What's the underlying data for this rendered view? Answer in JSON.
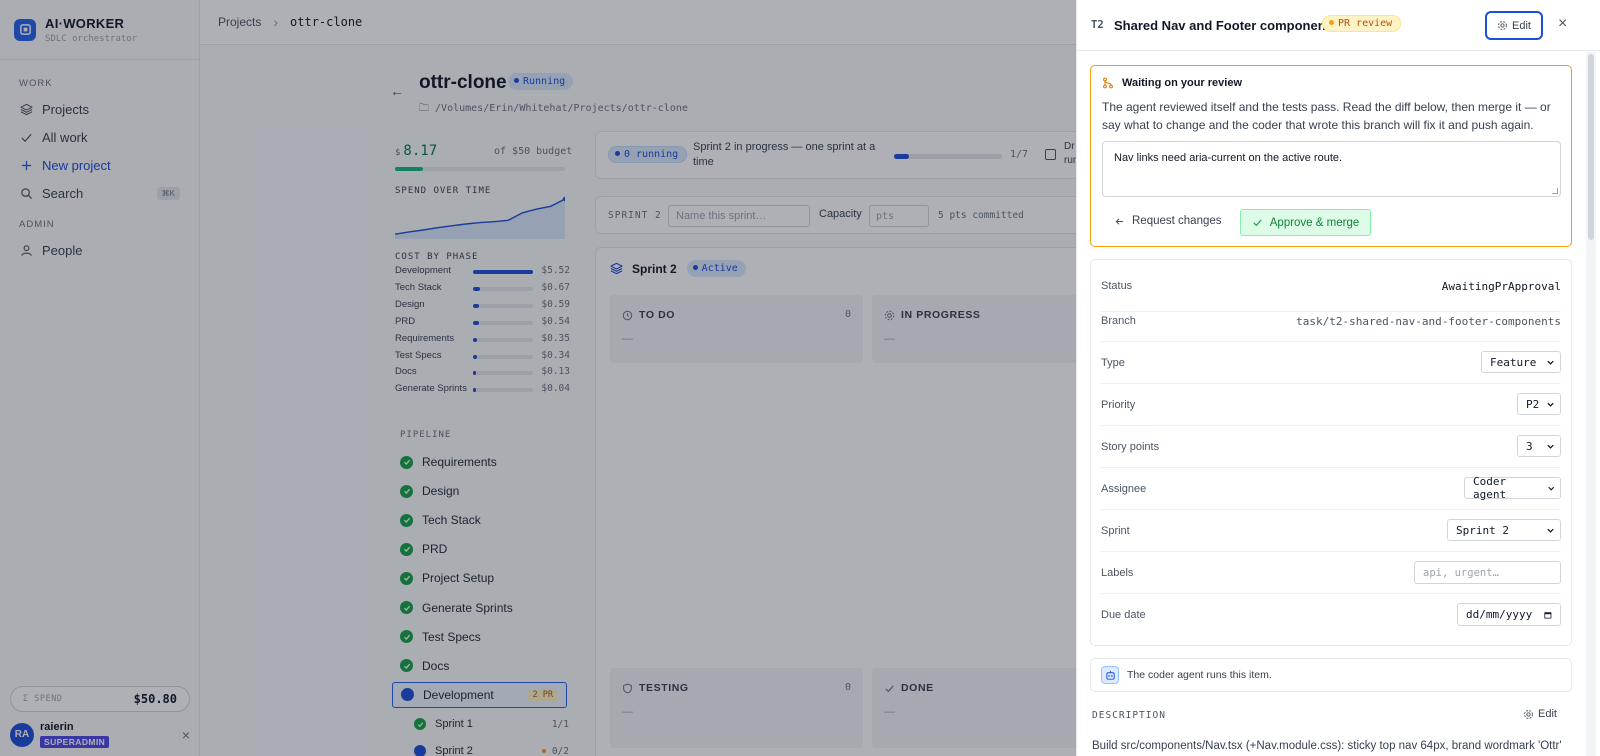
{
  "sidebar": {
    "brand": {
      "name": "AI·WORKER",
      "subtitle": "SDLC orchestrator"
    },
    "sections": {
      "work": "WORK",
      "admin": "ADMIN"
    },
    "items": [
      {
        "label": "Projects",
        "icon": "layers-icon"
      },
      {
        "label": "All work",
        "icon": "check-icon"
      },
      {
        "label": "New project",
        "icon": "plus-icon"
      },
      {
        "label": "Search",
        "icon": "search-icon",
        "shortcut": "⌘K"
      },
      {
        "label": "People",
        "icon": "person-icon"
      }
    ],
    "spend": {
      "label": "Σ SPEND",
      "value": "$50.80"
    },
    "user": {
      "initials": "RA",
      "name": "raierin",
      "role": "SUPERADMIN"
    }
  },
  "breadcrumb": {
    "root": "Projects",
    "current": "ottr-clone"
  },
  "project": {
    "name": "ottr-clone",
    "status": "Running",
    "path": "/Volumes/Erin/Whitehat/Projects/ottr-clone",
    "cost": {
      "currency": "$",
      "value": "8.17",
      "budget_text": "of $50 budget",
      "fraction": 0.163
    },
    "labels": {
      "spend_over_time": "SPEND OVER TIME",
      "cost_by_phase": "COST BY PHASE",
      "pipeline": "PIPELINE"
    },
    "spend_series": [
      0.6,
      1.1,
      1.5,
      2.0,
      2.4,
      2.8,
      3.1,
      3.3,
      3.6,
      5.2,
      6.0,
      6.6,
      8.17
    ],
    "phases": [
      {
        "name": "Development",
        "value": "$5.52",
        "amount": 5.52
      },
      {
        "name": "Tech Stack",
        "value": "$0.67",
        "amount": 0.67
      },
      {
        "name": "Design",
        "value": "$0.59",
        "amount": 0.59
      },
      {
        "name": "PRD",
        "value": "$0.54",
        "amount": 0.54
      },
      {
        "name": "Requirements",
        "value": "$0.35",
        "amount": 0.35
      },
      {
        "name": "Test Specs",
        "value": "$0.34",
        "amount": 0.34
      },
      {
        "name": "Docs",
        "value": "$0.13",
        "amount": 0.13
      },
      {
        "name": "Generate Sprints",
        "value": "$0.04",
        "amount": 0.04
      }
    ],
    "pipeline": [
      {
        "name": "Requirements"
      },
      {
        "name": "Design"
      },
      {
        "name": "Tech Stack"
      },
      {
        "name": "PRD"
      },
      {
        "name": "Project Setup"
      },
      {
        "name": "Generate Sprints"
      },
      {
        "name": "Test Specs"
      },
      {
        "name": "Docs"
      },
      {
        "name": "Development",
        "badge": "2 PR"
      }
    ],
    "sprints": [
      {
        "name": "Sprint 1",
        "count": "1/1"
      },
      {
        "name": "Sprint 2",
        "count": "0/2"
      }
    ]
  },
  "status_card": {
    "running": "0 running",
    "text": "Sprint 2 in progress — one sprint at a time",
    "progress": "1/7",
    "progress_fraction": 0.143,
    "dry_run_label": "Dr\nrun"
  },
  "sprint_bar": {
    "label": "SPRINT 2",
    "name_placeholder": "Name this sprint…",
    "capacity_label": "Capacity",
    "capacity_placeholder": "pts",
    "committed": "5 pts committed"
  },
  "board": {
    "name": "Sprint 2",
    "status": "Active",
    "columns": [
      {
        "title": "TO DO",
        "count": "0",
        "empty": "—"
      },
      {
        "title": "IN PROGRESS",
        "count": "",
        "empty": "—"
      },
      {
        "title": "TESTING",
        "count": "0",
        "empty": "—"
      },
      {
        "title": "DONE",
        "count": "",
        "empty": "—"
      }
    ]
  },
  "drawer": {
    "task_id": "T2",
    "title": "Shared Nav and Footer components",
    "status_pill": "PR review",
    "edit_label": "Edit",
    "close": "×",
    "review": {
      "heading": "Waiting on your review",
      "text": "The agent reviewed itself and the tests pass. Read the diff below, then merge it — or say what to change and the coder that wrote this branch will fix it and push again.",
      "feedback": "Nav links need aria-current on the active route.",
      "request_changes": "Request changes",
      "approve": "Approve & merge"
    },
    "fields": {
      "status": {
        "label": "Status",
        "value": "AwaitingPrApproval"
      },
      "branch": {
        "label": "Branch",
        "value": "task/t2-shared-nav-and-footer-components"
      },
      "type": {
        "label": "Type",
        "value": "Feature"
      },
      "priority": {
        "label": "Priority",
        "value": "P2"
      },
      "points": {
        "label": "Story points",
        "value": "3"
      },
      "assignee": {
        "label": "Assignee",
        "value": "Coder agent"
      },
      "sprint": {
        "label": "Sprint",
        "value": "Sprint 2"
      },
      "labels": {
        "label": "Labels",
        "placeholder": "api, urgent…"
      },
      "due": {
        "label": "Due date",
        "value": "dd/mm/yyyy"
      }
    },
    "agent_note": "The coder agent runs this item.",
    "description": {
      "label": "DESCRIPTION",
      "edit": "Edit",
      "text": "Build src/components/Nav.tsx (+Nav.module.css): sticky top nav 64px, brand wordmark 'Ottr'"
    }
  },
  "colors": {
    "accent": "#1d4ed8",
    "success": "#16a34a",
    "warning": "#f59e0b",
    "overlay": "rgba(17,24,39,0.34)"
  }
}
